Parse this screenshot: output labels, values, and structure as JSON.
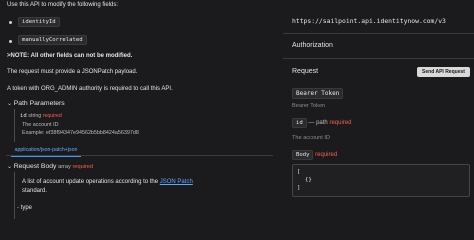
{
  "left": {
    "intro": "Use this API to modify the following fields:",
    "fields": [
      "identityId",
      "manuallyCorrelated"
    ],
    "note": ">NOTE: All other fields can not be modified.",
    "jsonpatch_note": "The request must provide a JSONPatch payload.",
    "token_note": "A token with ORG_ADMIN authority is required to call this API.",
    "path_params": {
      "title": "Path Parameters",
      "param_name": "id",
      "param_type": "string",
      "param_required": "required",
      "param_desc": "The account ID",
      "param_example": "Example: ef38f94347e94562b5bb8424a56397d8"
    },
    "content_tab": "application/json-patch+json",
    "request_body": {
      "title": "Request Body",
      "type": "array",
      "required": "required",
      "desc_prefix": "A list of account update operations according to the",
      "desc_link": "JSON Patch",
      "desc_suffix": "standard.",
      "item": "type"
    }
  },
  "right": {
    "base_url": "https://sailpoint.api.identitynow.com/v3",
    "authorization_title": "Authorization",
    "request_title": "Request",
    "send_button": "Send API Request",
    "bearer_token_label": "Bearer Token",
    "bearer_token_placeholder": "Bearer Token",
    "id_label": "id",
    "id_path": "— path",
    "id_required": "required",
    "id_placeholder": "The account ID",
    "body_label": "Body",
    "body_required": "required",
    "body_lines": [
      "[",
      "{}",
      "]"
    ]
  }
}
